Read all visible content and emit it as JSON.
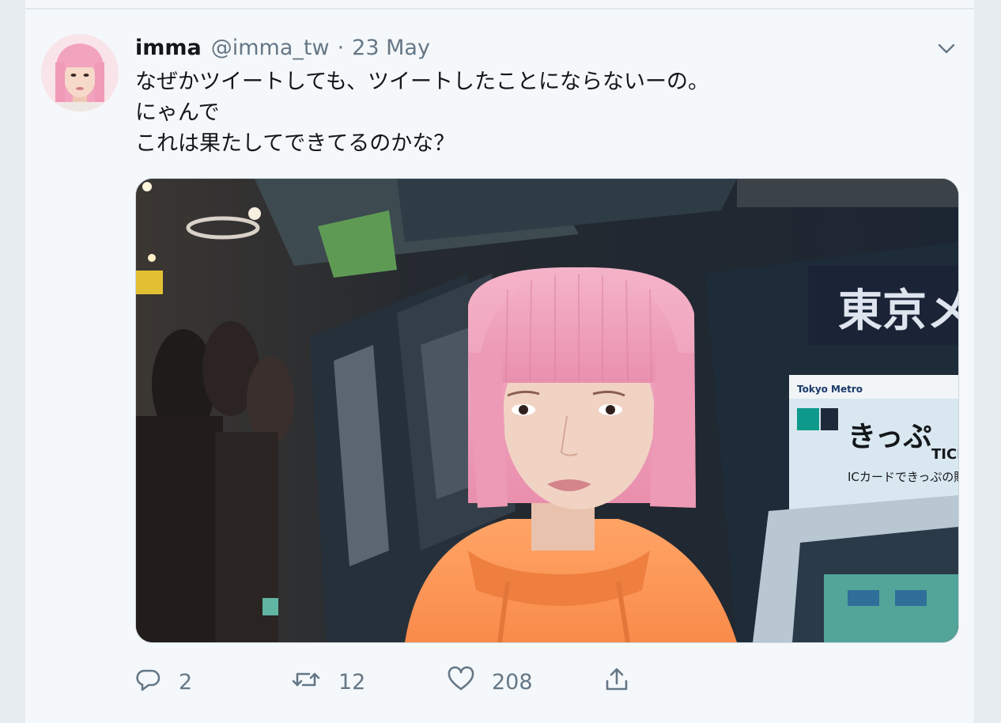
{
  "tweet": {
    "author_name": "imma",
    "handle": "@imma_tw",
    "separator": "·",
    "date": "23 May",
    "text_lines": [
      "なぜかツイートしても、ツイートしたことにならないーの。",
      "にゃんで",
      "これは果たしてできてるのかな？"
    ],
    "media": {
      "sign_station": "東京メ",
      "sign_brand": "Tokyo Metro",
      "sign_ticket": "きっぷ",
      "sign_ticket_en": "TICI",
      "sign_ic": "ICカードできっぷの購入"
    }
  },
  "actions": {
    "reply_count": "2",
    "retweet_count": "12",
    "like_count": "208"
  },
  "icons": {
    "caret": "chevron-down-icon",
    "reply": "reply-icon",
    "retweet": "retweet-icon",
    "like": "heart-icon",
    "share": "share-icon"
  },
  "colors": {
    "text_primary": "#14171a",
    "text_secondary": "#657786",
    "background": "#f5f8fa",
    "hair_pink": "#f0a6bf",
    "hoodie_orange": "#ff9a57"
  }
}
